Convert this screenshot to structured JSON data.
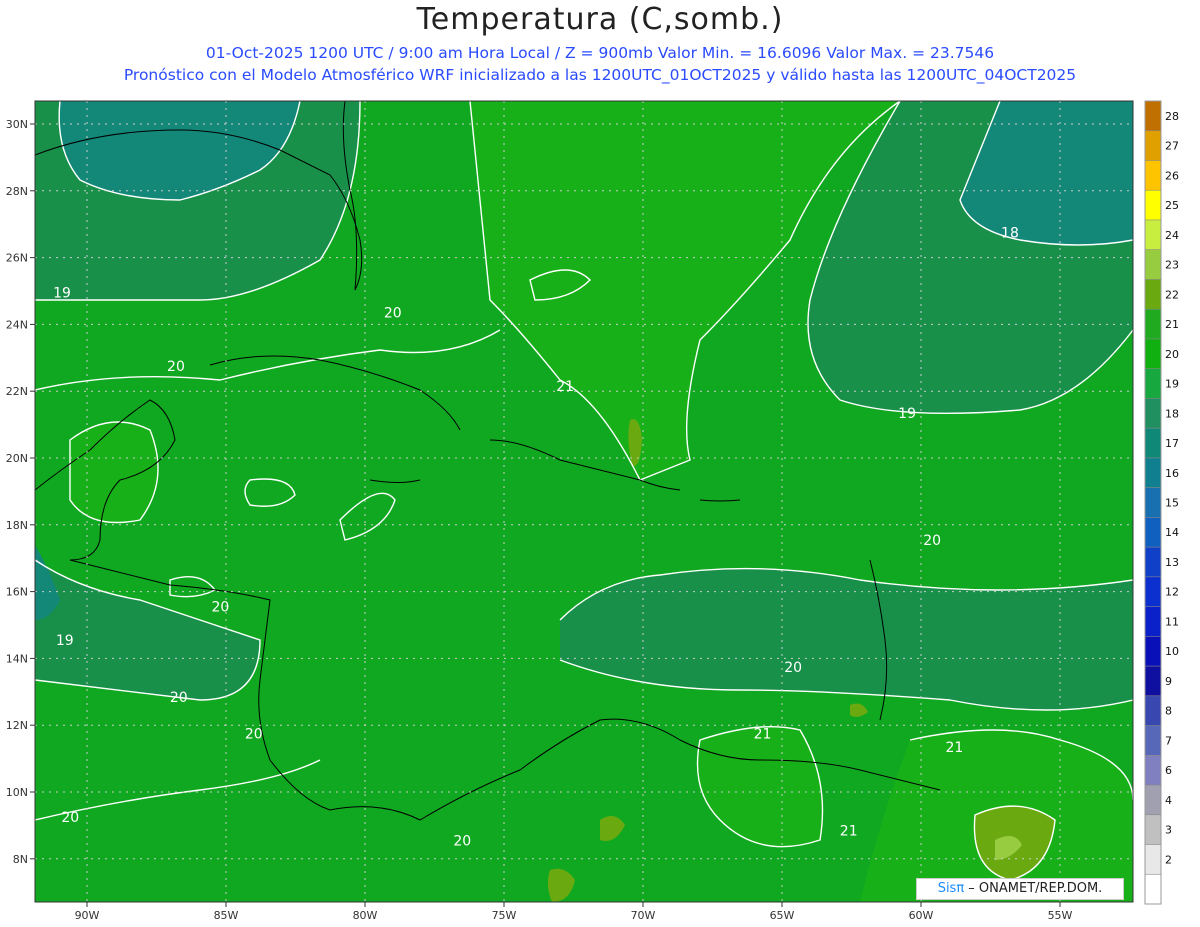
{
  "header": {
    "title": "Temperatura (C,somb.)",
    "line1": "01-Oct-2025   1200 UTC / 9:00 am Hora Local / Z = 900mb     Valor Min. = 16.6096  Valor Max. = 23.7546",
    "line2": "Pronóstico con el Modelo Atmosférico WRF inicializado a las 1200UTC_01OCT2025 y válido hasta las  1200UTC_04OCT2025"
  },
  "map": {
    "lat_labels": [
      "30N",
      "28N",
      "26N",
      "24N",
      "22N",
      "20N",
      "18N",
      "16N",
      "14N",
      "12N",
      "10N",
      "8N"
    ],
    "lon_labels": [
      "90W",
      "85W",
      "80W",
      "75W",
      "70W",
      "65W",
      "60W",
      "55W"
    ],
    "lat_values": [
      30,
      28,
      26,
      24,
      22,
      20,
      18,
      16,
      14,
      12,
      10,
      8
    ],
    "lon_values": [
      -90,
      -85,
      -80,
      -75,
      -70,
      -65,
      -60,
      -55
    ],
    "contour_labels": [
      {
        "text": "19",
        "lon": -90.9,
        "lat": 24.8
      },
      {
        "text": "20",
        "lon": -79.0,
        "lat": 24.2
      },
      {
        "text": "20",
        "lon": -86.8,
        "lat": 22.6
      },
      {
        "text": "21",
        "lon": -72.8,
        "lat": 22.0
      },
      {
        "text": "18",
        "lon": -56.8,
        "lat": 26.6
      },
      {
        "text": "19",
        "lon": -60.5,
        "lat": 21.2
      },
      {
        "text": "20",
        "lon": -59.6,
        "lat": 17.4
      },
      {
        "text": "20",
        "lon": -85.2,
        "lat": 15.4
      },
      {
        "text": "19",
        "lon": -90.8,
        "lat": 14.4
      },
      {
        "text": "20",
        "lon": -64.6,
        "lat": 13.6
      },
      {
        "text": "20",
        "lon": -86.7,
        "lat": 12.7
      },
      {
        "text": "20",
        "lon": -84.0,
        "lat": 11.6
      },
      {
        "text": "21",
        "lon": -65.7,
        "lat": 11.6
      },
      {
        "text": "21",
        "lon": -58.8,
        "lat": 11.2
      },
      {
        "text": "21",
        "lon": -62.6,
        "lat": 8.7
      },
      {
        "text": "20",
        "lon": -90.6,
        "lat": 9.1
      },
      {
        "text": "20",
        "lon": -76.5,
        "lat": 8.4
      }
    ]
  },
  "colorbar": {
    "labels": [
      "28",
      "27",
      "26",
      "25",
      "24",
      "23",
      "22",
      "21",
      "20",
      "19",
      "18",
      "17",
      "16",
      "15",
      "14",
      "13",
      "12",
      "11",
      "10",
      "9",
      "8",
      "7",
      "6",
      "4",
      "3",
      "2"
    ],
    "colors": [
      "#c07000",
      "#e0a000",
      "#ffc400",
      "#ffff00",
      "#c8ee40",
      "#98cc40",
      "#6aaa10",
      "#20aa20",
      "#10b010",
      "#18a840",
      "#209060",
      "#108878",
      "#108090",
      "#1870b0",
      "#1060c0",
      "#1040c8",
      "#0c30d0",
      "#0a20c8",
      "#0a10b8",
      "#1010a0",
      "#3848b0",
      "#5868b8",
      "#8080c0",
      "#a0a0b0",
      "#c0c0c0",
      "#e8e8e8",
      "#ffffff"
    ]
  },
  "credit": {
    "brand": "Sisπ",
    "text": " – ONAMET/REP.DOM."
  }
}
